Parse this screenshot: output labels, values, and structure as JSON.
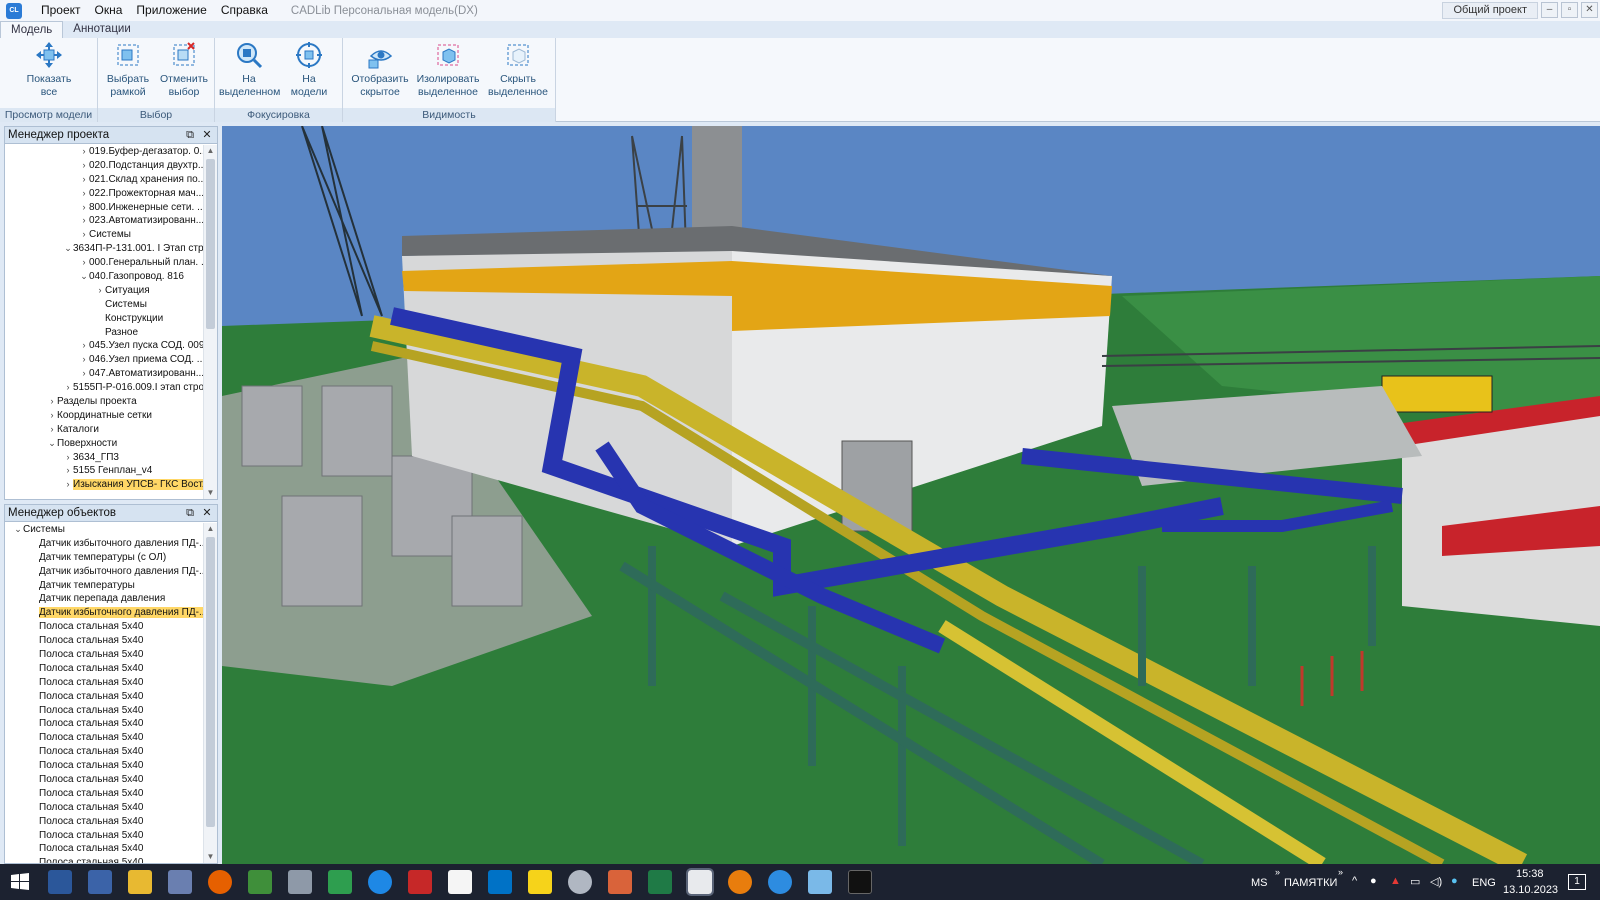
{
  "app": {
    "menu": [
      "Проект",
      "Окна",
      "Приложение",
      "Справка"
    ],
    "title": "CADLib Персональная модель(DX)",
    "project_button": "Общий проект",
    "icon_text": "CL"
  },
  "ribbon": {
    "tabs": [
      "Модель",
      "Аннотации"
    ],
    "groups": {
      "view": "Просмотр модели",
      "select": "Выбор",
      "focus": "Фокусировка",
      "visibility": "Видимость"
    },
    "buttons": {
      "show_all": "Показать все",
      "select_frame_1": "Выбрать",
      "select_frame_2": "рамкой",
      "cancel_sel_1": "Отменить",
      "cancel_sel_2": "выбор",
      "on_selected_1": "На",
      "on_selected_2": "выделенном",
      "on_model_1": "На",
      "on_model_2": "модели",
      "show_hidden_1": "Отобразить",
      "show_hidden_2": "скрытое",
      "isolate_1": "Изолировать",
      "isolate_2": "выделенное",
      "hide_sel_1": "Скрыть",
      "hide_sel_2": "выделенное"
    }
  },
  "project_manager": {
    "title": "Менеджер проекта",
    "items": [
      {
        "level": 3,
        "expander": ">",
        "label": "019.Буфер-дегазатор. 0..."
      },
      {
        "level": 3,
        "expander": ">",
        "label": "020.Подстанция двухтр..."
      },
      {
        "level": 3,
        "expander": ">",
        "label": "021.Склад хранения по..."
      },
      {
        "level": 3,
        "expander": ">",
        "label": "022.Прожекторная мач..."
      },
      {
        "level": 3,
        "expander": ">",
        "label": "800.Инженерные сети. ..."
      },
      {
        "level": 3,
        "expander": ">",
        "label": "023.Автоматизированн..."
      },
      {
        "level": 3,
        "expander": ">",
        "label": "Системы"
      },
      {
        "level": 2,
        "expander": "v",
        "label": "3634П-Р-131.001. I Этап стр..."
      },
      {
        "level": 3,
        "expander": ">",
        "label": "000.Генеральный план. ..."
      },
      {
        "level": 3,
        "expander": "v",
        "label": "040.Газопровод. 816"
      },
      {
        "level": 4,
        "expander": ">",
        "label": "Ситуация"
      },
      {
        "level": 4,
        "expander": "",
        "label": "Системы"
      },
      {
        "level": 4,
        "expander": "",
        "label": "Конструкции"
      },
      {
        "level": 4,
        "expander": "",
        "label": "Разное"
      },
      {
        "level": 3,
        "expander": ">",
        "label": "045.Узел пуска СОД. 009"
      },
      {
        "level": 3,
        "expander": ">",
        "label": "046.Узел приема СОД. ..."
      },
      {
        "level": 3,
        "expander": ">",
        "label": "047.Автоматизированн..."
      },
      {
        "level": 2,
        "expander": ">",
        "label": "5155П-Р-016.009.I этап стро..."
      },
      {
        "level": 1,
        "expander": ">",
        "label": "Разделы проекта"
      },
      {
        "level": 1,
        "expander": ">",
        "label": "Координатные сетки"
      },
      {
        "level": 1,
        "expander": ">",
        "label": "Каталоги"
      },
      {
        "level": 1,
        "expander": "v",
        "label": "Поверхности"
      },
      {
        "level": 2,
        "expander": ">",
        "label": "3634_ГП3"
      },
      {
        "level": 2,
        "expander": ">",
        "label": "5155 Генплан_v4"
      },
      {
        "level": 2,
        "expander": ">",
        "label": "Изыскания УПСВ- ГКС Вост...",
        "selected": true
      }
    ]
  },
  "object_manager": {
    "title": "Менеджер объектов",
    "items": [
      {
        "level": 0,
        "expander": "v",
        "label": "Системы"
      },
      {
        "level": 1,
        "expander": "",
        "label": "Датчик избыточного давления ПД-..."
      },
      {
        "level": 1,
        "expander": "",
        "label": "Датчик температуры (с ОЛ)"
      },
      {
        "level": 1,
        "expander": "",
        "label": "Датчик избыточного давления ПД-..."
      },
      {
        "level": 1,
        "expander": "",
        "label": "Датчик температуры"
      },
      {
        "level": 1,
        "expander": "",
        "label": "Датчик перепада давления"
      },
      {
        "level": 1,
        "expander": "",
        "label": "Датчик избыточного давления ПД-...",
        "selected": true
      },
      {
        "level": 1,
        "expander": "",
        "label": "Полоса стальная 5х40"
      },
      {
        "level": 1,
        "expander": "",
        "label": "Полоса стальная 5х40"
      },
      {
        "level": 1,
        "expander": "",
        "label": "Полоса стальная 5х40"
      },
      {
        "level": 1,
        "expander": "",
        "label": "Полоса стальная 5х40"
      },
      {
        "level": 1,
        "expander": "",
        "label": "Полоса стальная 5х40"
      },
      {
        "level": 1,
        "expander": "",
        "label": "Полоса стальная 5х40"
      },
      {
        "level": 1,
        "expander": "",
        "label": "Полоса стальная 5х40"
      },
      {
        "level": 1,
        "expander": "",
        "label": "Полоса стальная 5х40"
      },
      {
        "level": 1,
        "expander": "",
        "label": "Полоса стальная 5х40"
      },
      {
        "level": 1,
        "expander": "",
        "label": "Полоса стальная 5х40"
      },
      {
        "level": 1,
        "expander": "",
        "label": "Полоса стальная 5х40"
      },
      {
        "level": 1,
        "expander": "",
        "label": "Полоса стальная 5х40"
      },
      {
        "level": 1,
        "expander": "",
        "label": "Полоса стальная 5х40"
      },
      {
        "level": 1,
        "expander": "",
        "label": "Полоса стальная 5х40"
      },
      {
        "level": 1,
        "expander": "",
        "label": "Полоса стальная 5х40"
      },
      {
        "level": 1,
        "expander": "",
        "label": "Полоса стальная 5х40"
      },
      {
        "level": 1,
        "expander": "",
        "label": "Полоса стальная 5х40"
      },
      {
        "level": 1,
        "expander": "",
        "label": "Полоса стальная 5х40"
      }
    ]
  },
  "taskbar": {
    "lang_indicator": "MS",
    "toolbar_label": "ПАМЯТКИ",
    "lang": "ENG",
    "time": "15:38",
    "date": "13.10.2023",
    "notif_count": "1"
  },
  "colors": {
    "sky": "#5a86c4",
    "ground": "#2e7d3a",
    "pipe_blue": "#2734b0",
    "pipe_yellow": "#c9b42a",
    "building_stripe": "#e3a515",
    "roof_red": "#c8232b",
    "selection": "#ffd766"
  }
}
